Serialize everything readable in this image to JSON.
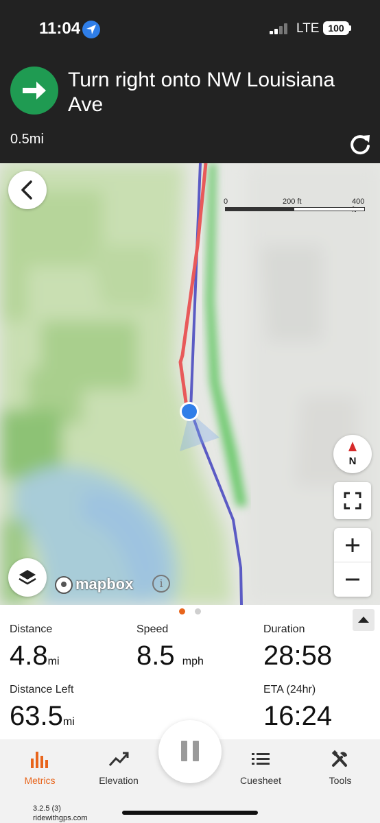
{
  "status_bar": {
    "time": "11:04",
    "network": "LTE",
    "battery": "100",
    "icons": [
      "location-arrow-icon",
      "signal-bars-icon",
      "battery-icon"
    ]
  },
  "navigation": {
    "instruction": "Turn right onto NW Louisiana Ave",
    "distance_to_turn": "0.5mi",
    "maneuver_icon": "arrow-right-icon",
    "accent_color": "#1f9b52",
    "reroute_icon": "refresh-icon"
  },
  "map": {
    "scale_labels": [
      "0",
      "200 ft",
      "400 ft"
    ],
    "attribution": "mapbox",
    "compass_label": "N",
    "route_colors": {
      "completed": "#e85a5a",
      "planned": "#5b5bc4",
      "position": "#2f7ee8"
    },
    "controls": [
      "back-button",
      "compass-button",
      "fullscreen-button",
      "zoom-in-button",
      "zoom-out-button",
      "layers-button",
      "info-button"
    ]
  },
  "metrics": {
    "page_count": 2,
    "active_page": 1,
    "distance": {
      "label": "Distance",
      "value": "4.8",
      "unit": "mi"
    },
    "speed": {
      "label": "Speed",
      "value": "8.5",
      "unit": "mph"
    },
    "duration": {
      "label": "Duration",
      "value": "28:58"
    },
    "distance_left": {
      "label": "Distance Left",
      "value": "63.5",
      "unit": "mi"
    },
    "eta": {
      "label": "ETA (24hr)",
      "value": "16:24"
    }
  },
  "tabs": [
    {
      "label": "Metrics",
      "icon": "bar-chart-icon",
      "active": true
    },
    {
      "label": "Elevation",
      "icon": "trend-line-icon",
      "active": false
    },
    {
      "label": "Cuesheet",
      "icon": "list-icon",
      "active": false
    },
    {
      "label": "Tools",
      "icon": "tools-icon",
      "active": false
    }
  ],
  "footer": {
    "version": "3.2.5 (3)",
    "site": "ridewithgps.com"
  },
  "colors": {
    "active_tab": "#e8651c",
    "header_bg": "#222222"
  }
}
